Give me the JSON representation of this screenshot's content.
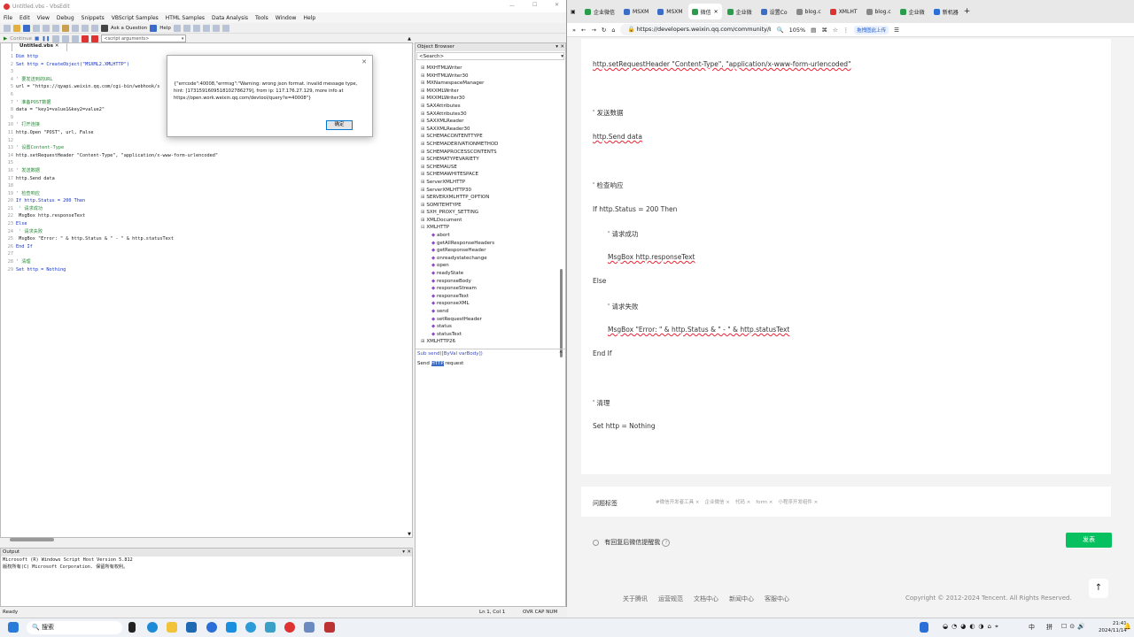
{
  "editor": {
    "title": "Untitled.vbs - VbsEdit",
    "menu": [
      "File",
      "Edit",
      "View",
      "Debug",
      "Snippets",
      "VBScript Samples",
      "HTML Samples",
      "Data Analysis",
      "Tools",
      "Window",
      "Help"
    ],
    "toolbar": {
      "ask": "Ask a Question",
      "help": "Help",
      "continue": "Continue",
      "script_args": "<script arguments>"
    },
    "doc_tab": "Untitled.vbs",
    "code_lines": [
      "Dim http",
      "Set http = CreateObject(\"MSXML2.XMLHTTP\")",
      "",
      "' 要发送到的URL",
      "url = \"https://qyapi.weixin.qq.com/cgi-bin/webhook/s",
      "",
      "' 准备POST数据",
      "data = \"key1=value1&key2=value2\"",
      "",
      "' 打开连接",
      "http.Open \"POST\", url, False",
      "",
      "' 设置Content-Type",
      "http.setRequestHeader \"Content-Type\", \"application/x-www-form-urlencoded\"",
      "",
      "' 发送数据",
      "http.Send data",
      "",
      "' 检查响应",
      "If http.Status = 200 Then",
      "    ' 请求成功",
      "    MsgBox http.responseText",
      "Else",
      "    ' 请求失败",
      "    MsgBox \"Error: \" & http.Status & \" - \" & http.statusText",
      "End If",
      "",
      "' 清理",
      "Set http = Nothing"
    ],
    "dialog": {
      "message": "{\"errcode\":40008,\"errmsg\":\"Warning: wrong json format. invalid message type, hint: [1731591609518102786279], from ip: 117.176.27.129, more info at https://open.work.weixin.qq.com/devtool/query?e=40008\"}",
      "ok": "确定"
    },
    "object_browser": {
      "title": "Object Browser",
      "search": "<Search>",
      "items": [
        "MXHTMLWriter",
        "MXHTMLWriter30",
        "MXNamespaceManager",
        "MXXMLWriter",
        "MXXMLWriter30",
        "SAXAttributes",
        "SAXAttributes30",
        "SAXXMLReader",
        "SAXXMLReader30",
        "SCHEMACONTENTTYPE",
        "SCHEMADERIVATIONMETHOD",
        "SCHEMAPROCESSCONTENTS",
        "SCHEMATYPEVARIETY",
        "SCHEMAUSE",
        "SCHEMAWHITESPACE",
        "ServerXMLHTTP",
        "ServerXMLHTTP30",
        "SERVERXMLHTTP_OPTION",
        "SOMITEMTYPE",
        "SXH_PROXY_SETTING",
        "XMLDocument",
        "XMLHTTP",
        "abort",
        "getAllResponseHeaders",
        "getResponseHeader",
        "onreadystatechange",
        "open",
        "readyState",
        "responseBody",
        "responseStream",
        "responseText",
        "responseXML",
        "send",
        "setRequestHeader",
        "status",
        "statusText",
        "XMLHTTP26"
      ],
      "signature": "Sub send([ByVal varBody])",
      "desc_pre": "Send ",
      "desc_hl": "HTTP",
      "desc_post": " request"
    },
    "output": {
      "title": "Output",
      "lines": [
        "Microsoft (R) Windows Script Host Version 5.812",
        "版权所有(C) Microsoft Corporation. 保留所有权利。"
      ]
    },
    "status": {
      "left": "Ready",
      "pos": "Ln 1, Col 1",
      "flags": "OVR CAP NUM"
    }
  },
  "browser": {
    "tabs": [
      "企业微信",
      "MSXM",
      "MSXM",
      "微信",
      "企业微",
      "设置Co",
      "blog.c",
      "XMLHT",
      "blog.c",
      "企业微",
      "新机器"
    ],
    "url": "https://developers.weixin.qq.com/community/blog",
    "zoom": "105%",
    "ext_label": "拖拽图此上传",
    "content": [
      "http.setRequestHeader  \"Content-Type\", \"application/x-www-form-urlencoded\"",
      "' 发送数据",
      "http.Send  data",
      "' 检查响应",
      "If  http.Status  =  200  Then",
      "' 请求成功",
      "MsgBox  http.responseText",
      "Else",
      "' 请求失败",
      "MsgBox  \"Error: \"  &  http.Status  &  \" - \"  &  http.statusText",
      "End  If",
      "' 清理",
      "Set  http  =  Nothing"
    ],
    "tags_label": "问题标签",
    "tags": [
      "#微信开发者工具",
      "企业微信",
      "代码",
      "form",
      "小程序开发组件"
    ],
    "notify": "有回复后微信提醒我",
    "publish": "发表",
    "footer_links": [
      "关于腾讯",
      "运营规范",
      "文档中心",
      "新闻中心",
      "客服中心"
    ],
    "copyright": "Copyright © 2012-2024 Tencent. All Rights Reserved."
  },
  "taskbar": {
    "search": "搜索",
    "time": "21:41",
    "date": "2024/11/14",
    "ime": "中",
    "ime2": "拼"
  }
}
